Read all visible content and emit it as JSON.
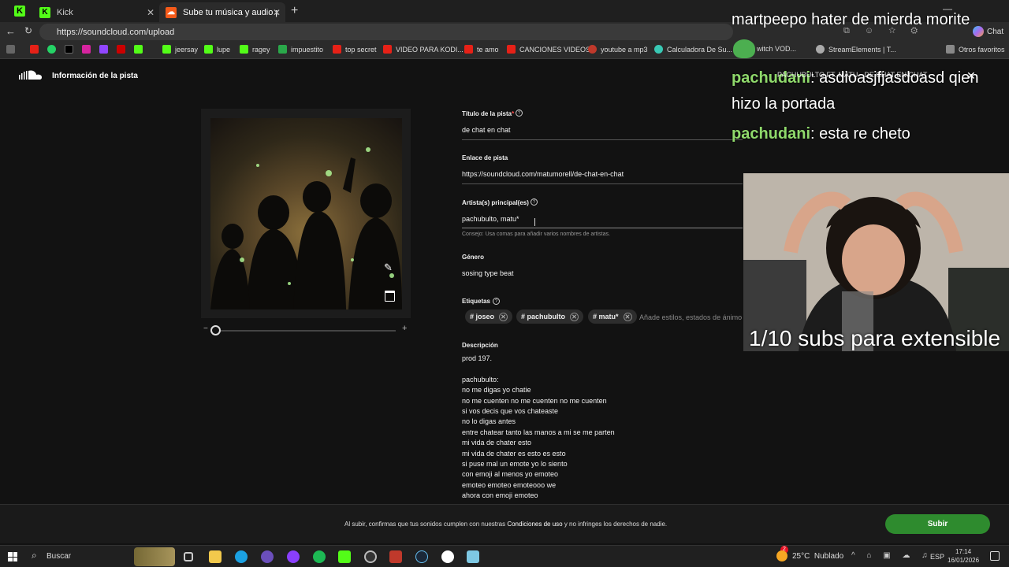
{
  "browser": {
    "tabs": [
      {
        "label": "Kick"
      },
      {
        "label": "Sube tu música y audio para comp"
      }
    ],
    "url": "https://soundcloud.com/upload",
    "bookmarks": [
      "jeersay",
      "lupe",
      "ragey",
      "impuestito",
      "top secret",
      "VIDEO PARA KODI...",
      "te amo",
      "CANCIONES VIDEOS",
      "youtube a mp3",
      "Calculadora De Su...",
      "witch VOD...",
      "StreamElements | T...",
      "Otros favoritos"
    ],
    "chat_button": "Chat"
  },
  "header": {
    "title": "Información de la pista"
  },
  "form": {
    "title_label": "Título de la pista",
    "title_required": "*",
    "title_value": "de chat en chat",
    "link_label": "Enlace de pista",
    "link_value": "https://soundcloud.com/matumorell/de-chat-en-chat",
    "artist_label": "Artista(s) principal(es)",
    "artist_value": "pachubulto, matu*",
    "artist_hint": "Consejo: Usa comas para añadir varios nombres de artistas.",
    "genre_label": "Género",
    "genre_value": "sosing type beat",
    "tags_label": "Etiquetas",
    "tags": [
      "# joseo",
      "# pachubulto",
      "# matu*"
    ],
    "tags_placeholder": "Añade estilos, estados de ánimo",
    "desc_label": "Descripción",
    "desc_lines": [
      "prod 197.",
      "",
      "pachubulto:",
      "no me digas yo chatie",
      "no me cuenten no me cuenten no me cuenten",
      "si vos decis que vos chateaste",
      "no lo digas antes",
      "entre chatear tanto las manos a mi se me parten",
      "mi vida de chater esto",
      "mi vida de chater es esto es esto",
      "si puse mal un emote yo lo siento",
      "con emoji al menos yo emoteo",
      "emoteo emoteo emoteooo we",
      "ahora con emoji emoteo"
    ]
  },
  "footer": {
    "notice_pre": "Al subir, confirmas que tus sonidos cumplen con nuestras ",
    "notice_link": "Condiciones de uso",
    "notice_post": " y no infringes los derechos de nadie.",
    "submit": "Subir"
  },
  "overlay": {
    "messages": [
      {
        "user": "",
        "text": "martpeepo hater de mierda morite"
      },
      {
        "user": "pachudani",
        "text": ": asdioasjfjasdoasd qien"
      },
      {
        "user": "",
        "text": "hizo la portada"
      },
      {
        "user": "pachudani",
        "text": ": esta re cheto"
      }
    ],
    "subs": "1/10 subs para extensible",
    "stream_title": "PACHUBULTO FT. MATU - DE CHAT EN CHAT"
  },
  "taskbar": {
    "search": "Buscar",
    "weather": "25°C  Nublado",
    "lang": "ESP",
    "time": "17:14",
    "date": "16/01/2026",
    "notif_badge": "2"
  },
  "colors": {
    "accent_green": "#2e8b2e",
    "chat_user": "#8fd96b"
  }
}
